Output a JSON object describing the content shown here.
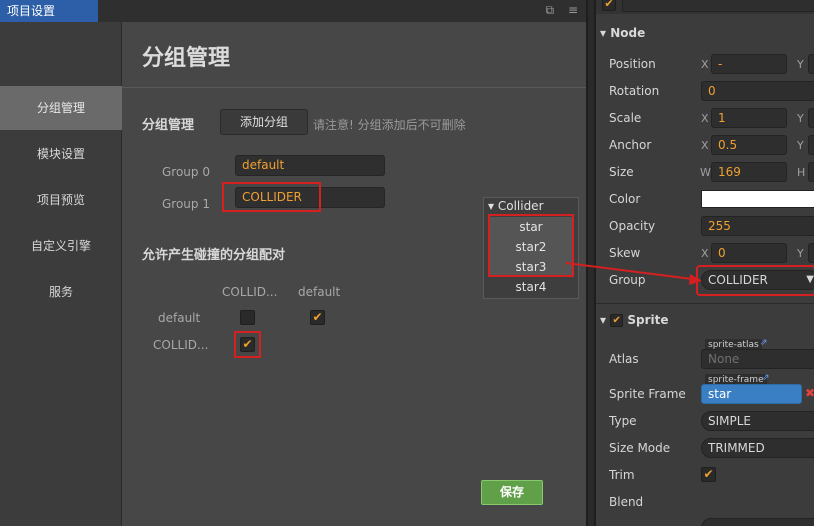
{
  "project_window": {
    "tab_title": "项目设置",
    "main_title": "分组管理",
    "sidebar": [
      {
        "label": "分组管理",
        "active": true
      },
      {
        "label": "模块设置",
        "active": false
      },
      {
        "label": "项目预览",
        "active": false
      },
      {
        "label": "自定义引擎",
        "active": false
      },
      {
        "label": "服务",
        "active": false
      }
    ],
    "group_section_label": "分组管理",
    "add_group_button": "添加分组",
    "warning": "请注意! 分组添加后不可删除",
    "groups": [
      {
        "label": "Group 0",
        "value": "default"
      },
      {
        "label": "Group 1",
        "value": "COLLIDER"
      }
    ],
    "pairs_title": "允许产生碰撞的分组配对",
    "matrix": {
      "columns": [
        "COLLID...",
        "default"
      ],
      "rows": [
        "default",
        "COLLID..."
      ],
      "checked": [
        [
          false,
          true
        ],
        [
          true
        ]
      ]
    },
    "save_button": "保存"
  },
  "collider_popup": {
    "header": "Collider",
    "items": [
      "star",
      "star2",
      "star3",
      "star4"
    ]
  },
  "inspector": {
    "node_section": "Node",
    "position": {
      "label": "Position",
      "x": "-",
      "y_axis": "Y"
    },
    "rotation": {
      "label": "Rotation",
      "value": "0"
    },
    "scale": {
      "label": "Scale",
      "x": "1"
    },
    "anchor": {
      "label": "Anchor",
      "x": "0.5"
    },
    "size": {
      "label": "Size",
      "w": "169",
      "w_axis": "W",
      "h_axis": "H"
    },
    "color": {
      "label": "Color"
    },
    "opacity": {
      "label": "Opacity",
      "value": "255"
    },
    "skew": {
      "label": "Skew",
      "x": "0"
    },
    "group": {
      "label": "Group",
      "value": "COLLIDER"
    },
    "sprite_section": "Sprite",
    "atlas": {
      "label": "Atlas",
      "tag": "sprite-atlas",
      "value": "None"
    },
    "sprite_frame": {
      "label": "Sprite Frame",
      "tag": "sprite-frame",
      "value": "star"
    },
    "type": {
      "label": "Type",
      "value": "SIMPLE"
    },
    "size_mode": {
      "label": "Size Mode",
      "value": "TRIMMED"
    },
    "trim": {
      "label": "Trim"
    },
    "blend": {
      "label": "Blend"
    },
    "axis_x": "X",
    "axis_y": "Y",
    "colors": {
      "accent": "#f0a030",
      "save": "#5fa049",
      "highlight_red": "#d42020",
      "sprite_frame_bg": "#3a7fc4"
    }
  }
}
